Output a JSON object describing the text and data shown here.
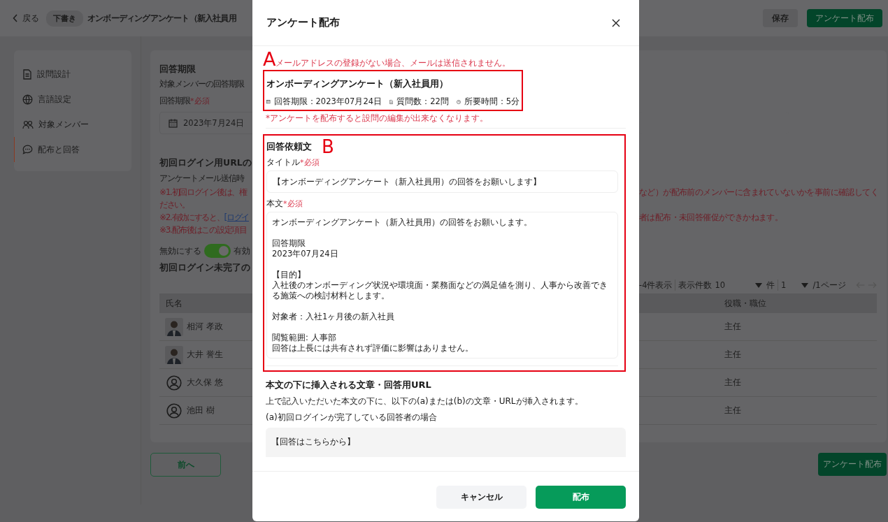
{
  "header": {
    "back": "戻る",
    "status_badge": "下書き",
    "title": "オンボーディングアンケート（新入社員用",
    "save_button": "保存",
    "distribute_button": "アンケート配布"
  },
  "sidebar": {
    "items": [
      {
        "label": "設問設計",
        "selected": false
      },
      {
        "label": "言語設定",
        "selected": false
      },
      {
        "label": "対象メンバー",
        "selected": false
      },
      {
        "label": "配布と回答",
        "selected": true
      }
    ]
  },
  "deadline_section": {
    "heading": "回答期限",
    "description": "対象メンバーの回答期限",
    "label": "回答期限",
    "required": "*必須",
    "date": "2023年7月24日"
  },
  "login_url_section": {
    "heading": "初回ログイン用URLの",
    "description": "アンケートメール送信時",
    "notes": [
      {
        "left": "※1.初回ログイン後は、権",
        "right": "など）が配布前のメンバーに含まれていないかを事前に確認してく"
      },
      {
        "left": "ださい。"
      },
      {
        "left": "※2.有効にすると、",
        "link": "[ログイ",
        "right": "者は配布・未回答催促ができかねます。"
      },
      {
        "left": "※3.配布後はこの設定項目"
      }
    ],
    "toggle": {
      "off_label": "無効にする",
      "on": true,
      "on_label": "有効"
    }
  },
  "members_section": {
    "heading": "初回ログイン未完了の",
    "pagination": {
      "range": "-4件表示",
      "per_page_label": "表示件数",
      "per_page": "10",
      "unit": "件",
      "page": "1",
      "page_total": "/1ページ"
    },
    "columns": [
      "氏名",
      "役職・職位"
    ],
    "rows": [
      {
        "name": "相河 孝政",
        "position": "主任"
      },
      {
        "name": "大井 誉生",
        "position": "主任"
      },
      {
        "kind": "icon",
        "name": "大久保 悠",
        "position": "主任"
      },
      {
        "kind": "icon",
        "name": "池田 樹",
        "position": "主任"
      }
    ]
  },
  "prev_button": "前へ",
  "bottom_distribute_button": "アンケート配布",
  "modal": {
    "title": "アンケート配布",
    "annotation_a": "A",
    "email_note": "メールアドレスの登録がない場合、メールは送信されません。",
    "survey": {
      "title": "オンボーディングアンケート（新入社員用）",
      "deadline": "回答期限：2023年07月24日",
      "questions": "質問数：22問",
      "duration": "所要時間：5分"
    },
    "edit_note": "*アンケートを配布すると設問の編集が出来なくなります。",
    "request": {
      "heading": "回答依頼文",
      "annotation_b": "B",
      "title_label": "タイトル",
      "title_required": "*必須",
      "title_value": "【オンボーディングアンケート（新入社員用）の回答をお願いします】",
      "body_label": "本文",
      "body_required": "*必須",
      "body_paragraphs": [
        [
          "オンボーディングアンケート（新入社員用）の回答をお願いします。"
        ],
        [
          "回答期限",
          "2023年07月24日"
        ],
        [
          "【目的】",
          "入社後のオンボーディング状況や環境面・業務面などの満足値を測り、人事から改善できる施策への検討材料とします。"
        ],
        [
          "対象者：入社1ヶ月後の新入社員"
        ],
        [
          "閲覧範囲: 人事部",
          "回答は上長には共有されず評価に影響はありません。"
        ]
      ]
    },
    "insert": {
      "heading": "本文の下に挿入される文章・回答用URL",
      "description": "上で記入いただいた本文の下に、以下の(a)または(b)の文章・URLが挿入されます。",
      "case_a": "(a)初回ログインが完了している回答者の場合",
      "preview": "【回答はこちらから】"
    },
    "cancel_button": "キャンセル",
    "distribute_button": "配布"
  }
}
